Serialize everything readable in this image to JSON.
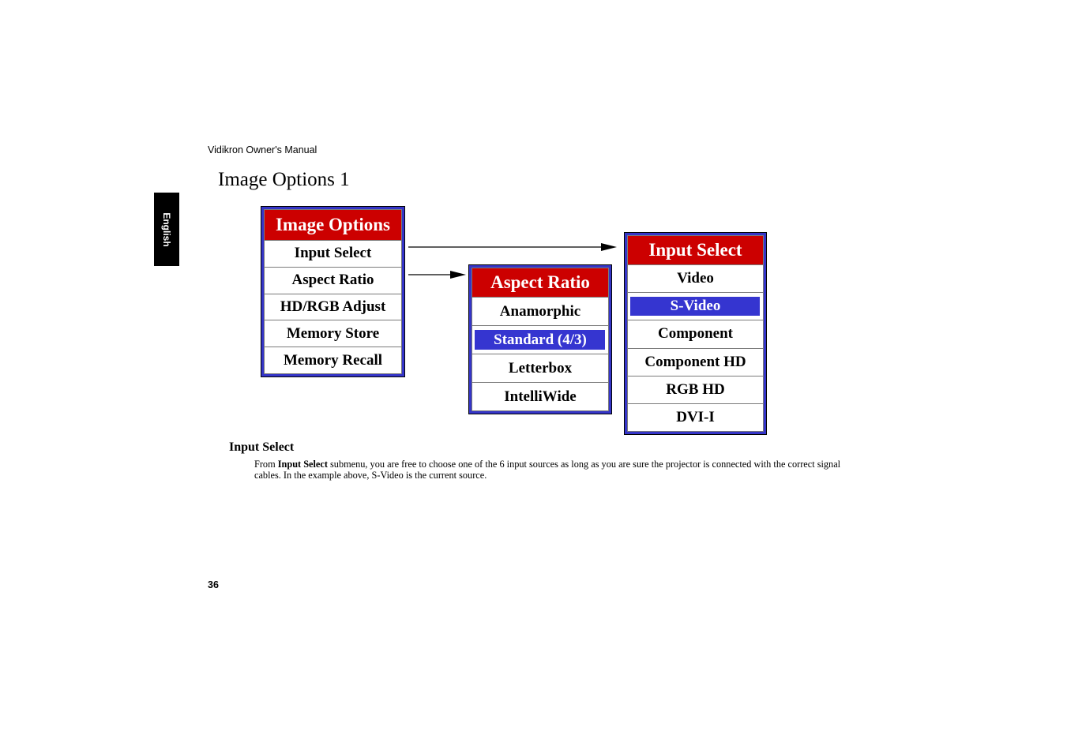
{
  "running_header": "Vidikron Owner's Manual",
  "page_title": "Image Options 1",
  "language_tab": "English",
  "colors": {
    "menu_frame": "#3535c8",
    "menu_header": "#cc0000",
    "selection": "#3535d0"
  },
  "menus": {
    "image_options": {
      "title": "Image Options",
      "items": [
        {
          "label": "Input Select",
          "selected": false
        },
        {
          "label": "Aspect Ratio",
          "selected": false
        },
        {
          "label": "HD/RGB Adjust",
          "selected": false
        },
        {
          "label": "Memory Store",
          "selected": false
        },
        {
          "label": "Memory Recall",
          "selected": false
        }
      ]
    },
    "aspect_ratio": {
      "title": "Aspect Ratio",
      "items": [
        {
          "label": "Anamorphic",
          "selected": false
        },
        {
          "label": "Standard (4/3)",
          "selected": true
        },
        {
          "label": "Letterbox",
          "selected": false
        },
        {
          "label": "IntelliWide",
          "selected": false
        }
      ]
    },
    "input_select": {
      "title": "Input Select",
      "items": [
        {
          "label": "Video",
          "selected": false
        },
        {
          "label": "S-Video",
          "selected": true
        },
        {
          "label": "Component",
          "selected": false
        },
        {
          "label": "Component HD",
          "selected": false
        },
        {
          "label": "RGB HD",
          "selected": false
        },
        {
          "label": "DVI-I",
          "selected": false
        }
      ]
    }
  },
  "section": {
    "heading": "Input Select",
    "body_prefix": "From ",
    "body_bold": "Input Select",
    "body_rest": " submenu, you are free to choose one of the 6 input sources as long as you are sure the projector is connected with the correct signal cables. In the example above, S-Video is the current source."
  },
  "page_number": "36"
}
